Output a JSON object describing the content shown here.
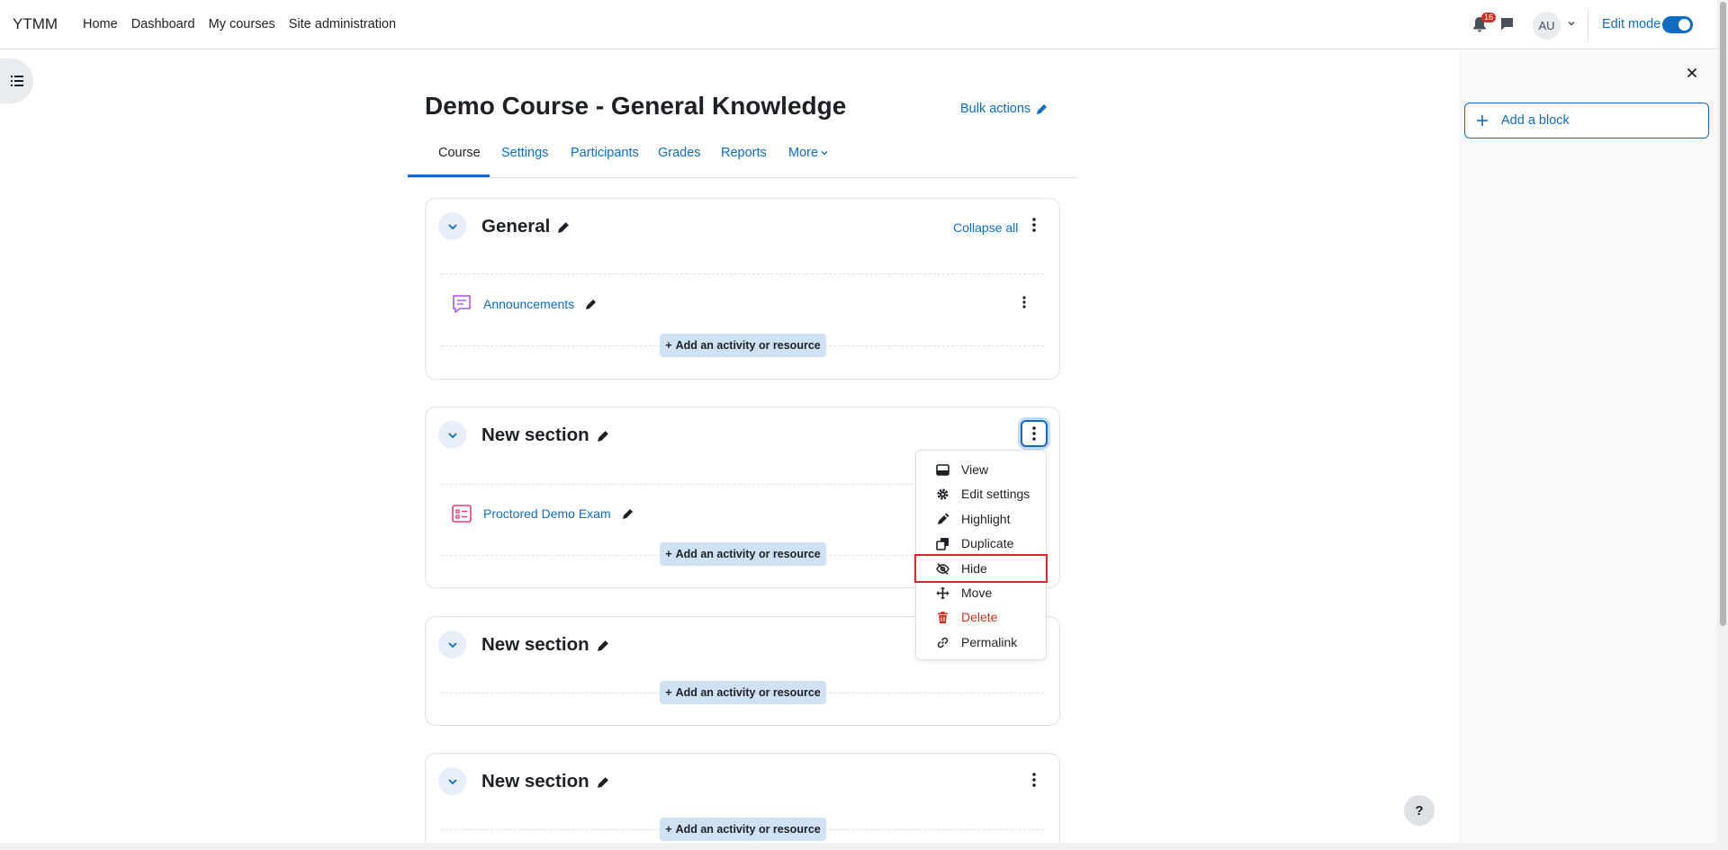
{
  "navbar": {
    "brand": "YTMM",
    "links": [
      "Home",
      "Dashboard",
      "My courses",
      "Site administration"
    ],
    "notification_count": "16",
    "avatar_initials": "AU",
    "edit_mode_label": "Edit mode",
    "edit_mode_on": true
  },
  "course": {
    "title": "Demo Course - General Knowledge",
    "bulk_actions": "Bulk actions",
    "tabs": [
      "Course",
      "Settings",
      "Participants",
      "Grades",
      "Reports",
      "More"
    ],
    "active_tab": "Course"
  },
  "sections": [
    {
      "title": "General",
      "collapse_all": "Collapse all",
      "activities": [
        {
          "name": "Announcements",
          "icon": "forum-icon"
        }
      ],
      "add_label": "Add an activity or resource"
    },
    {
      "title": "New section",
      "activities": [
        {
          "name": "Proctored Demo Exam",
          "icon": "quiz-icon"
        }
      ],
      "add_label": "Add an activity or resource"
    },
    {
      "title": "New section",
      "activities": [],
      "add_label": "Add an activity or resource"
    },
    {
      "title": "New section",
      "activities": [],
      "add_label": "Add an activity or resource"
    }
  ],
  "section_menu": {
    "items": [
      {
        "label": "View",
        "icon": "view-icon"
      },
      {
        "label": "Edit settings",
        "icon": "gear-icon"
      },
      {
        "label": "Highlight",
        "icon": "highlight-icon"
      },
      {
        "label": "Duplicate",
        "icon": "duplicate-icon"
      },
      {
        "label": "Hide",
        "icon": "eye-slash-icon"
      },
      {
        "label": "Move",
        "icon": "move-icon"
      },
      {
        "label": "Delete",
        "icon": "trash-icon"
      },
      {
        "label": "Permalink",
        "icon": "link-icon"
      }
    ],
    "highlighted_item": "Hide"
  },
  "block_drawer": {
    "add_block_label": "Add a block"
  },
  "help_label": "?",
  "colors": {
    "link": "#0f6cbf",
    "danger": "#ca3120",
    "highlight_border": "#d9292e"
  }
}
